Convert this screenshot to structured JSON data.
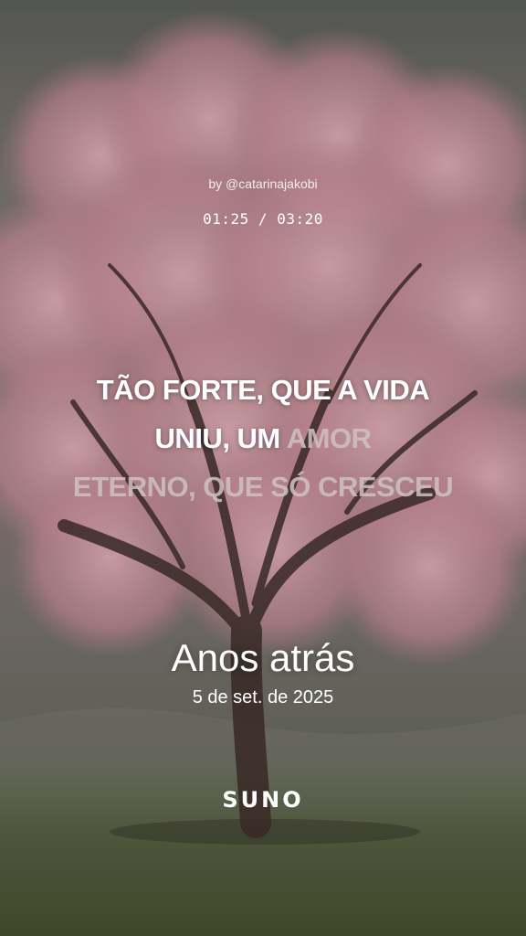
{
  "credit": "by @catarinajakobi",
  "playback": {
    "time": "01:25 / 03:20",
    "progress": 0.425
  },
  "lyrics": {
    "line1": {
      "sung": "TÃO FORTE, QUE A VIDA",
      "unsung": ""
    },
    "line2": {
      "sung": "UNIU, UM ",
      "unsung": "AMOR"
    },
    "line3": {
      "sung": "",
      "unsung": "ETERNO, QUE SÓ CRESCEU"
    }
  },
  "song": {
    "title": "Anos atrás",
    "date": "5 de set. de 2025"
  },
  "brand": {
    "logo": "SUNO"
  },
  "colors": {
    "blossom": "#d49aa6",
    "sky": "#5d605a",
    "grass": "#4d5639",
    "sung_text": "#ffffff",
    "unsung_text": "#cfc2c4"
  }
}
